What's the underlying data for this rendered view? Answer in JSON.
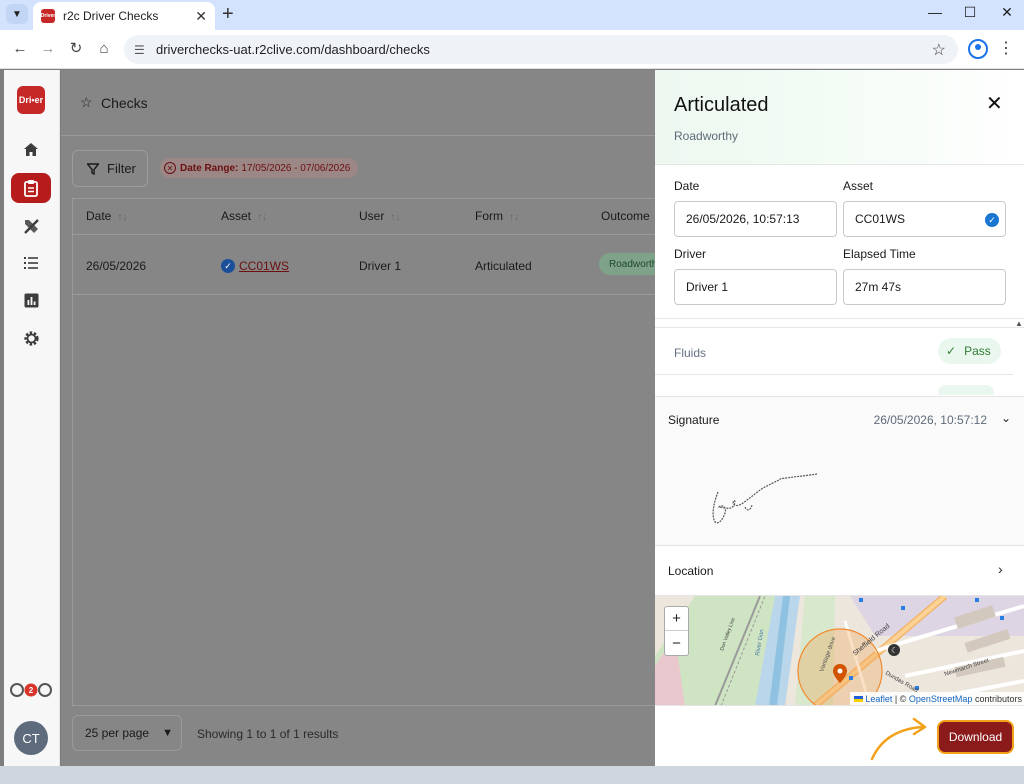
{
  "browser": {
    "tab_title": "r2c Driver Checks",
    "favicon_text": "Driver",
    "url": "driverchecks-uat.r2clive.com/dashboard/checks",
    "icons": [
      "tab-search-icon",
      "close-icon",
      "new-tab-icon",
      "minimize-icon",
      "maximize-icon",
      "close-window-icon",
      "back-icon",
      "forward-icon",
      "reload-icon",
      "home-icon",
      "site-info-icon",
      "star-icon",
      "profile-icon",
      "menu-icon"
    ]
  },
  "sidebar": {
    "logo_text": "Dri•er",
    "items": [
      "home",
      "checks",
      "tools",
      "list",
      "reports",
      "settings"
    ],
    "bottom_logo": "r2c",
    "avatar_initials": "CT"
  },
  "main": {
    "title": "Checks",
    "filter_label": "Filter",
    "chip_label": "Date Range:",
    "chip_value": "17/05/2026 - 07/06/2026",
    "columns": [
      "Date",
      "Asset",
      "User",
      "Form",
      "Outcome"
    ],
    "rows": [
      {
        "date": "26/05/2026",
        "asset": "CC01WS",
        "user": "Driver 1",
        "form": "Articulated",
        "outcome": "Roadworthy"
      }
    ],
    "per_page": "25 per page",
    "results_text": "Showing 1 to 1 of 1 results"
  },
  "drawer": {
    "title": "Articulated",
    "subtitle": "Roadworthy",
    "date_label": "Date",
    "date_value": "26/05/2026, 10:57:13",
    "asset_label": "Asset",
    "asset_value": "CC01WS",
    "driver_label": "Driver",
    "driver_value": "Driver 1",
    "elapsed_label": "Elapsed Time",
    "elapsed_value": "27m 47s",
    "fluids_label": "Fluids",
    "fluids_result": "Pass",
    "signature_label": "Signature",
    "signature_time": "26/05/2026, 10:57:12",
    "location_label": "Location",
    "map": {
      "zoom_in": "+",
      "zoom_out": "−",
      "attrib_leaflet": "Leaflet",
      "attrib_sep": "| ©",
      "attrib_osm": "OpenStreetMap",
      "attrib_contrib": "contributors",
      "street_labels": [
        "Sheffield Road",
        "Vantage drive",
        "River Don",
        "Newmarch Street",
        "Dundas Road",
        "Don Valley Line"
      ]
    },
    "download_label": "Download"
  },
  "colors": {
    "brand_red": "#b71c1c",
    "download_bg": "#8b1a1a",
    "pass_green": "#2e7d32",
    "verified_blue": "#1976d2",
    "annotation_orange": "#f2a11a"
  }
}
